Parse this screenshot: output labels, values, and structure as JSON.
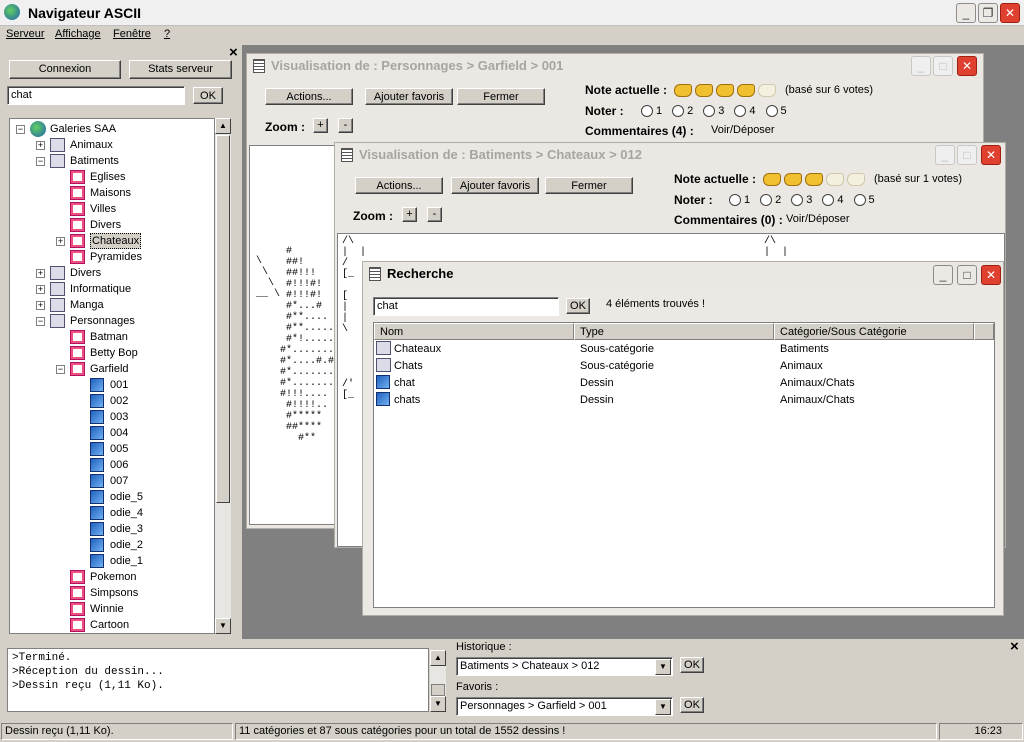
{
  "app": {
    "title": "Navigateur ASCII"
  },
  "menu": [
    "Serveur",
    "Affichage",
    "Fenêtre",
    "?"
  ],
  "left": {
    "connect": "Connexion",
    "stats": "Stats serveur",
    "search_value": "chat",
    "ok": "OK",
    "close_glyph": "×"
  },
  "tree": [
    {
      "label": "Galeries SAA",
      "level": 0,
      "icon": "globe-icon",
      "exp": "−"
    },
    {
      "label": "Animaux",
      "level": 1,
      "icon": "folder-icon",
      "exp": "+"
    },
    {
      "label": "Batiments",
      "level": 1,
      "icon": "folder-icon",
      "exp": "−"
    },
    {
      "label": "Eglises",
      "level": 2,
      "icon": "category-icon",
      "exp": ""
    },
    {
      "label": "Maisons",
      "level": 2,
      "icon": "category-icon",
      "exp": ""
    },
    {
      "label": "Villes",
      "level": 2,
      "icon": "category-icon",
      "exp": ""
    },
    {
      "label": "Divers",
      "level": 2,
      "icon": "category-icon",
      "exp": ""
    },
    {
      "label": "Chateaux",
      "level": 2,
      "icon": "category-icon",
      "exp": "+",
      "selected": true
    },
    {
      "label": "Pyramides",
      "level": 2,
      "icon": "category-icon",
      "exp": ""
    },
    {
      "label": "Divers",
      "level": 1,
      "icon": "folder-icon",
      "exp": "+"
    },
    {
      "label": "Informatique",
      "level": 1,
      "icon": "folder-icon",
      "exp": "+"
    },
    {
      "label": "Manga",
      "level": 1,
      "icon": "folder-icon",
      "exp": "+"
    },
    {
      "label": "Personnages",
      "level": 1,
      "icon": "folder-icon",
      "exp": "−"
    },
    {
      "label": "Batman",
      "level": 2,
      "icon": "category-icon",
      "exp": ""
    },
    {
      "label": "Betty Bop",
      "level": 2,
      "icon": "category-icon",
      "exp": ""
    },
    {
      "label": "Garfield",
      "level": 2,
      "icon": "category-icon",
      "exp": "−"
    },
    {
      "label": "001",
      "level": 3,
      "icon": "image-icon",
      "exp": ""
    },
    {
      "label": "002",
      "level": 3,
      "icon": "image-icon",
      "exp": ""
    },
    {
      "label": "003",
      "level": 3,
      "icon": "image-icon",
      "exp": ""
    },
    {
      "label": "004",
      "level": 3,
      "icon": "image-icon",
      "exp": ""
    },
    {
      "label": "005",
      "level": 3,
      "icon": "image-icon",
      "exp": ""
    },
    {
      "label": "006",
      "level": 3,
      "icon": "image-icon",
      "exp": ""
    },
    {
      "label": "007",
      "level": 3,
      "icon": "image-icon",
      "exp": ""
    },
    {
      "label": "odie_5",
      "level": 3,
      "icon": "image-icon",
      "exp": ""
    },
    {
      "label": "odie_4",
      "level": 3,
      "icon": "image-icon",
      "exp": ""
    },
    {
      "label": "odie_3",
      "level": 3,
      "icon": "image-icon",
      "exp": ""
    },
    {
      "label": "odie_2",
      "level": 3,
      "icon": "image-icon",
      "exp": ""
    },
    {
      "label": "odie_1",
      "level": 3,
      "icon": "image-icon",
      "exp": ""
    },
    {
      "label": "Pokemon",
      "level": 2,
      "icon": "category-icon",
      "exp": ""
    },
    {
      "label": "Simpsons",
      "level": 2,
      "icon": "category-icon",
      "exp": ""
    },
    {
      "label": "Winnie",
      "level": 2,
      "icon": "category-icon",
      "exp": ""
    },
    {
      "label": "Cartoon",
      "level": 2,
      "icon": "category-icon",
      "exp": ""
    }
  ],
  "win1": {
    "title": "Visualisation de : Personnages > Garfield > 001",
    "actions": "Actions...",
    "fav": "Ajouter favoris",
    "close": "Fermer",
    "note_label": "Note actuelle :",
    "votes": "(basé sur 6 votes)",
    "rating": 4,
    "noter": "Noter :",
    "options": [
      "1",
      "2",
      "3",
      "4",
      "5"
    ],
    "comments": "Commentaires (4) :",
    "comments_link": "Voir/Déposer",
    "zoom": "Zoom :",
    "plus": "+",
    "minus": "-"
  },
  "win2": {
    "title": "Visualisation de : Batiments > Chateaux > 012",
    "actions": "Actions...",
    "fav": "Ajouter favoris",
    "close": "Fermer",
    "note_label": "Note actuelle :",
    "votes": "(basé sur 1 votes)",
    "rating": 3,
    "noter": "Noter :",
    "options": [
      "1",
      "2",
      "3",
      "4",
      "5"
    ],
    "comments": "Commentaires (0) :",
    "comments_link": "Voir/Déposer",
    "zoom": "Zoom :",
    "plus": "+",
    "minus": "-"
  },
  "search": {
    "title": "Recherche",
    "value": "chat",
    "ok": "OK",
    "result_text": "4 éléments trouvés !",
    "columns": [
      "Nom",
      "Type",
      "Catégorie/Sous Catégorie"
    ],
    "rows": [
      {
        "name": "Chateaux",
        "type": "Sous-catégorie",
        "cat": "Batiments",
        "icon": "folder-icon"
      },
      {
        "name": "Chats",
        "type": "Sous-catégorie",
        "cat": "Animaux",
        "icon": "folder-icon"
      },
      {
        "name": "chat",
        "type": "Dessin",
        "cat": "Animaux/Chats",
        "icon": "image-icon"
      },
      {
        "name": "chats",
        "type": "Dessin",
        "cat": "Animaux/Chats",
        "icon": "image-icon"
      }
    ]
  },
  "log": {
    "lines": [
      ">Terminé.",
      ">Réception du dessin...",
      ">Dessin reçu (1,11 Ko)."
    ]
  },
  "history": {
    "label": "Historique :",
    "value": "Batiments > Chateaux > 012",
    "ok": "OK"
  },
  "favorites": {
    "label": "Favoris :",
    "value": "Personnages > Garfield > 001",
    "ok": "OK"
  },
  "status": {
    "left": "Dessin reçu (1,11 Ko).",
    "middle": "11 catégories et 87 sous catégories pour un total de 1552 dessins !",
    "time": "16:23"
  },
  "ascii1": "  #\n  ##!\n  ##!!!\n  #!!!#!\n  #!!!#!\n  #*...#\n  #**....\n  #**.....\n  #*!.....\n #*.......\n #*....#.#\n #*.......\n #*.......\n #!!!....\n  #!!!!..\n  #*****\n  ##****\n    #**",
  "ascii2": "/\\\n|  |\n/\n[_\n \n[\n|\n|\n\\\n \n \n \n \n/'\n[_",
  "ascii3": "\\\n \\\n  \\\n__ \\"
}
